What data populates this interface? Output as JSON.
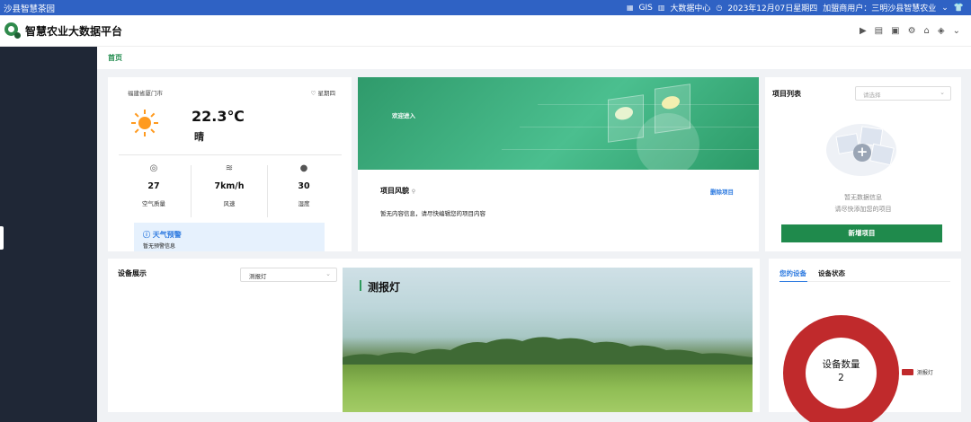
{
  "topbar": {
    "site_name": "沙县智慧茶园",
    "gis": "GIS",
    "bigdata": "大数据中心",
    "datetime": "2023年12月07日星期四",
    "user": "加盟商用户：三明沙县智慧农业"
  },
  "header": {
    "brand": "智慧农业大数据平台"
  },
  "breadcrumb": {
    "home": "首页"
  },
  "weather": {
    "location": "福建省厦门市",
    "weekday": "星期四",
    "temperature": "22.3℃",
    "condition": "晴",
    "stats": [
      {
        "value": "27",
        "label": "空气质量",
        "icon": "air-quality-icon"
      },
      {
        "value": "7km/h",
        "label": "风速",
        "icon": "wind-icon"
      },
      {
        "value": "30",
        "label": "湿度",
        "icon": "humidity-icon"
      }
    ],
    "alert": {
      "title": "天气预警",
      "text": "暂无预警信息"
    }
  },
  "welcome": {
    "greeting": "欢迎进入",
    "project_title": "项目风貌",
    "delete_label": "删除项目",
    "empty_text": "暂无内容信息，请尽快编辑您的项目内容"
  },
  "project_list": {
    "title": "项目列表",
    "select_placeholder": "请选择",
    "empty_line1": "暂无数据信息",
    "empty_line2": "请尽快添加您的项目",
    "add_button": "新增项目"
  },
  "devices": {
    "title": "设备展示",
    "selected": "测报灯",
    "photo_title": "测报灯"
  },
  "device_stats": {
    "tab_mine": "您的设备",
    "tab_status": "设备状态",
    "donut_label": "设备数量",
    "donut_value": "2",
    "legend": "测报灯",
    "color": "#c02a2c"
  },
  "colors": {
    "primary_green": "#1f8a4c",
    "topbar_blue": "#2f62c4",
    "sidebar": "#1f2736"
  }
}
